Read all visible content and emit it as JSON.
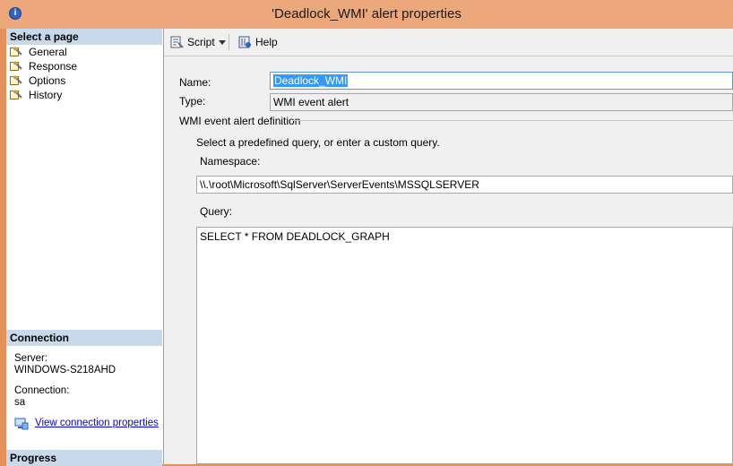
{
  "window": {
    "title": "'Deadlock_WMI' alert properties",
    "icon": "info-icon"
  },
  "left_pane": {
    "select_page_header": "Select a page",
    "pages": [
      {
        "label": "General",
        "icon": "page-wrench-icon",
        "selected": true
      },
      {
        "label": "Response",
        "icon": "page-wrench-icon"
      },
      {
        "label": "Options",
        "icon": "page-wrench-icon"
      },
      {
        "label": "History",
        "icon": "page-wrench-icon"
      }
    ],
    "connection_header": "Connection",
    "server_label": "Server:",
    "server_value": "WINDOWS-S218AHD",
    "connection_label": "Connection:",
    "connection_value": "sa",
    "view_connection_link": "View connection properties",
    "progress_header": "Progress"
  },
  "toolbar": {
    "script_label": "Script",
    "help_label": "Help"
  },
  "form": {
    "name_label": "Name:",
    "name_value": "Deadlock_WMI",
    "type_label": "Type:",
    "type_value": "WMI event alert",
    "group_title": "WMI event alert definition",
    "instruction": "Select a predefined query, or enter a custom query.",
    "namespace_label": "Namespace:",
    "namespace_value": "\\\\.\\root\\Microsoft\\SqlServer\\ServerEvents\\MSSQLSERVER",
    "query_label": "Query:",
    "query_value": "SELECT * FROM DEADLOCK_GRAPH"
  },
  "colors": {
    "title_bar": "#eca77a",
    "window_border": "#e6905a",
    "section_header": "#c7d9ea",
    "selection": "#3399ff",
    "link": "#0000ee"
  }
}
